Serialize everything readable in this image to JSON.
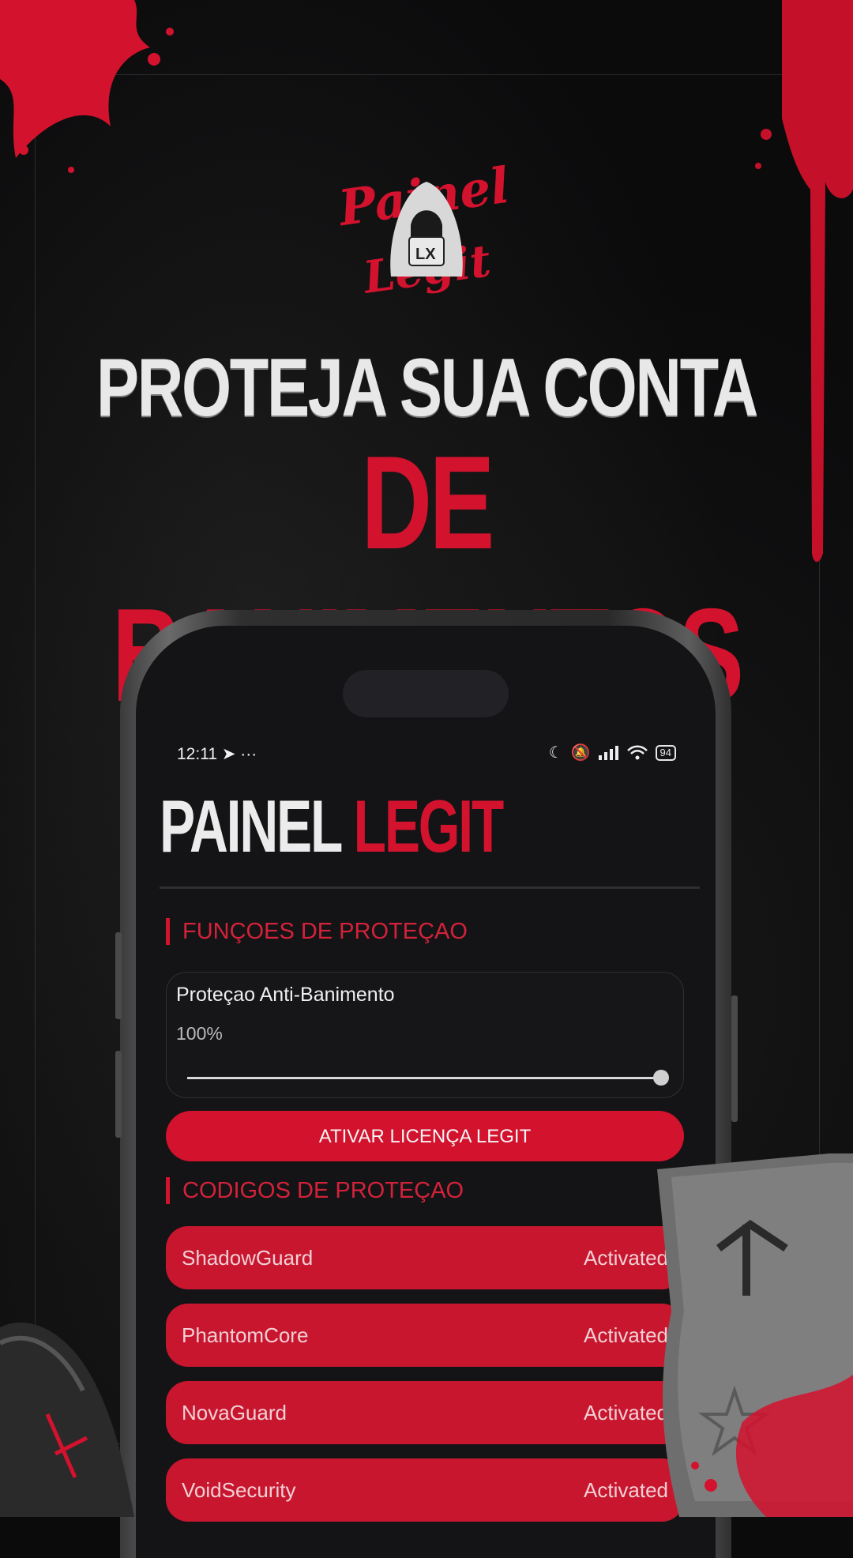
{
  "headline": {
    "line1": "PROTEJA SUA CONTA",
    "line2": "DE BANIMENTOS"
  },
  "logo": {
    "script_text": "Painel Legit",
    "badge_text": "LX",
    "icon": "hooded-figure-icon"
  },
  "status_bar": {
    "time": "12:11",
    "left_icons": [
      "telegram-icon",
      "more-icon"
    ],
    "right_icons": [
      "moon-icon",
      "bell-muted-icon",
      "signal-icon",
      "wifi-icon"
    ],
    "battery": "94"
  },
  "app": {
    "title_part1": "PAINEL",
    "title_part2": "LEGIT",
    "section1_title": "FUNÇOES DE PROTEÇAO",
    "protection_card": {
      "label": "Proteçao Anti-Banimento",
      "value_text": "100%",
      "slider_level": 1.0
    },
    "activate_button": "ATIVAR LICENÇA LEGIT",
    "section2_title": "CODIGOS DE PROTEÇAO",
    "codes": [
      {
        "name": "ShadowGuard",
        "status": "Activated"
      },
      {
        "name": "PhantomCore",
        "status": "Activated"
      },
      {
        "name": "NovaGuard",
        "status": "Activated"
      },
      {
        "name": "VoidSecurity",
        "status": "Activated"
      }
    ]
  },
  "colors": {
    "accent": "#d3122e",
    "background": "#0b0b0c",
    "screen": "#141416"
  }
}
